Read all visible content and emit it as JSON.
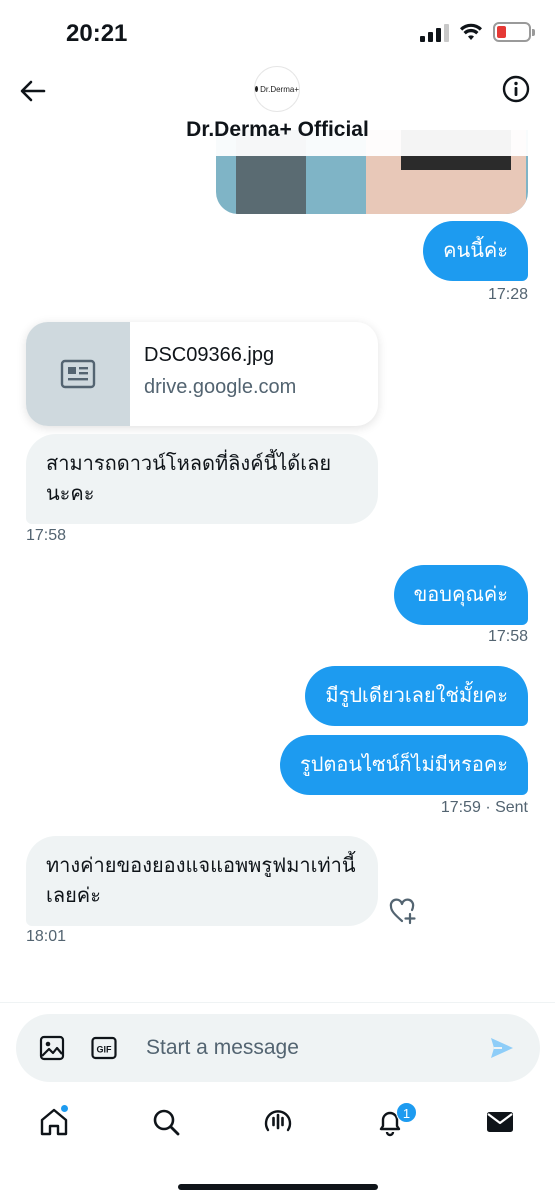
{
  "status_bar": {
    "time": "20:21"
  },
  "header": {
    "title": "Dr.Derma+ Official",
    "avatar_text": "Dr.Derma+"
  },
  "messages": [
    {
      "text": "คนนี้ค่ะ",
      "direction": "out",
      "time": "17:28"
    },
    {
      "type": "link_card",
      "title": "DSC09366.jpg",
      "domain": "drive.google.com"
    },
    {
      "text": "สามารถดาวน์โหลดที่ลิงค์นี้ได้เลย นะคะ",
      "direction": "in",
      "time": "17:58"
    },
    {
      "text": "ขอบคุณค่ะ",
      "direction": "out",
      "time": "17:58"
    },
    {
      "text": "มีรูปเดียวเลยใช่มั้ยคะ",
      "direction": "out"
    },
    {
      "text": "รูปตอนไซน์ก็ไม่มีหรอคะ",
      "direction": "out",
      "time": "17:59",
      "status": "· Sent"
    },
    {
      "text": "ทางค่ายของยองแจแอพพรูฟมาเท่านี้เลยค่ะ",
      "direction": "in",
      "time": "18:01"
    }
  ],
  "composer": {
    "placeholder": "Start a message",
    "gif_label": "GIF"
  },
  "tabbar": {
    "items": [
      "home-icon",
      "search-icon",
      "spaces-icon",
      "notifications-icon",
      "messages-icon"
    ],
    "notifications_count": "1"
  },
  "colors": {
    "accent": "#1d9bf0",
    "incoming_bubble": "#eff3f4",
    "text": "#0f1419",
    "muted": "#536471"
  }
}
